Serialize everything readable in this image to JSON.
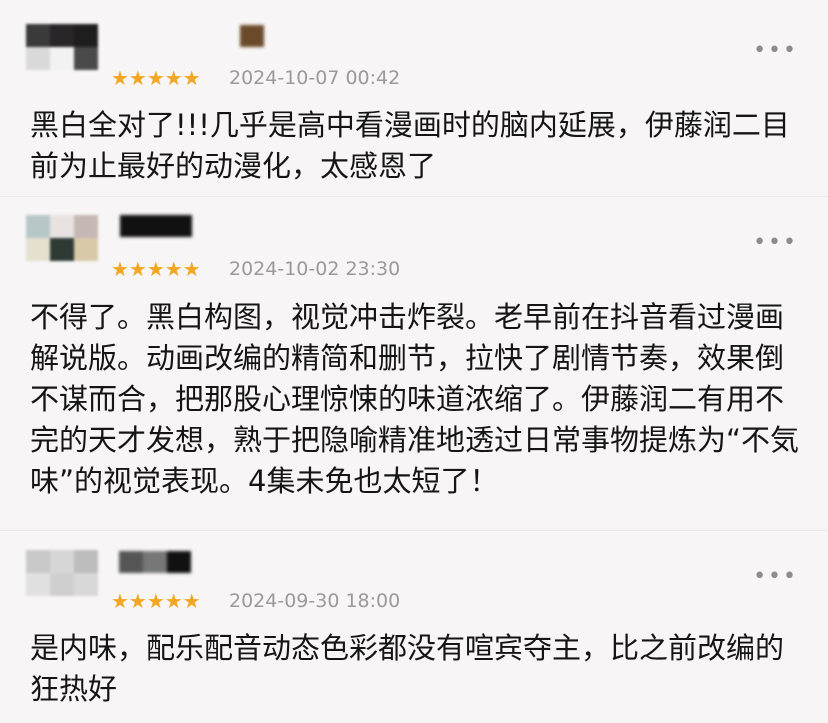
{
  "reviews": [
    {
      "rating_stars": "★★★★★",
      "rating": 5,
      "timestamp": "2024-10-07 00:42",
      "more_icon": "more-dots-icon",
      "text": "黑白全对了!!!几乎是高中看漫画时的脑内延展，伊藤润二目前为止最好的动漫化，太感恩了"
    },
    {
      "rating_stars": "★★★★★",
      "rating": 5,
      "timestamp": "2024-10-02 23:30",
      "more_icon": "more-dots-icon",
      "text": "不得了。黑白构图，视觉冲击炸裂。老早前在抖音看过漫画解说版。动画改编的精简和删节，拉快了剧情节奏，效果倒不谋而合，把那股心理惊悚的味道浓缩了。伊藤润二有用不完的天才发想，熟于把隐喻精准地透过日常事物提炼为“不気味”的视觉表现。4集未免也太短了！"
    },
    {
      "rating_stars": "★★★★★",
      "rating": 5,
      "timestamp": "2024-09-30 18:00",
      "more_icon": "more-dots-icon",
      "text": "是内味，配乐配音动态色彩都没有喧宾夺主，比之前改编的狂热好"
    }
  ],
  "colors": {
    "background": "#f7f5f5",
    "star": "#f2a622",
    "timestamp": "#9a9a9a"
  }
}
